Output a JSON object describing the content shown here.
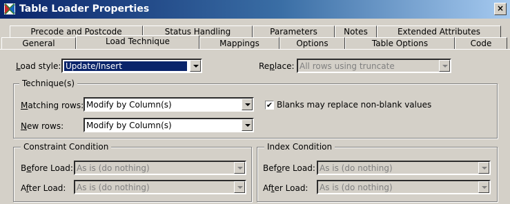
{
  "window": {
    "title": "Table Loader Properties",
    "close_glyph": "×",
    "app_icon": "table-loader-icon"
  },
  "tabs": {
    "row_back": [
      "Precode and Postcode",
      "Status Handling",
      "Parameters",
      "Notes",
      "Extended Attributes"
    ],
    "row_front": [
      "General",
      "Load Technique",
      "Mappings",
      "Options",
      "Table Options",
      "Code"
    ],
    "active": "Load Technique"
  },
  "load_style": {
    "label_accel": "L",
    "label_rest": "oad style:",
    "value": "Update/Insert"
  },
  "replace": {
    "label_pre": "Re",
    "label_accel": "p",
    "label_rest": "lace:",
    "value": "All rows using truncate"
  },
  "technique": {
    "title": "Technique(s)",
    "matching_rows": {
      "label_accel": "M",
      "label_rest": "atching rows:",
      "value": "Modify by Column(s)"
    },
    "new_rows": {
      "label_accel": "N",
      "label_rest": "ew rows:",
      "value": "Modify by Column(s)"
    },
    "blanks_checkbox": {
      "label": "Blanks may replace non-blank values",
      "checked_glyph": "✔"
    }
  },
  "constraint_condition": {
    "title": "Constraint Condition",
    "before_load": {
      "label_pre": "B",
      "label_accel": "e",
      "label_rest": "fore Load:",
      "value": "As is (do nothing)"
    },
    "after_load": {
      "label_pre": "A",
      "label_accel": "f",
      "label_rest": "ter Load:",
      "value": "As is (do nothing)"
    }
  },
  "index_condition": {
    "title": "Index Condition",
    "before_load": {
      "label_pre": "Bef",
      "label_accel": "o",
      "label_rest": "re Load:",
      "value": "As is (do nothing)"
    },
    "after_load": {
      "label_pre": "Af",
      "label_accel": "t",
      "label_rest": "er Load:",
      "value": "As is (do nothing)"
    }
  }
}
